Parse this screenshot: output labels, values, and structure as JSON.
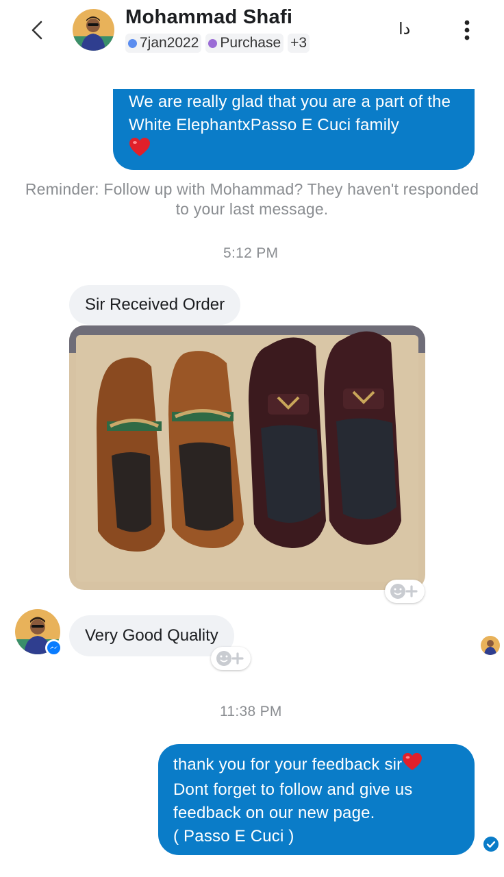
{
  "header": {
    "contact_name": "Mohammad Shafi",
    "tags": [
      {
        "label": "7jan2022",
        "color": "#5b8def"
      },
      {
        "label": "Purchase",
        "color": "#9b6cd6"
      }
    ],
    "more_tags": "+3",
    "translate_label": "دا",
    "icons": {
      "back": "chevron-left-icon",
      "more": "vertical-ellipsis-icon"
    }
  },
  "messages": {
    "m1": {
      "text": "We are really glad that you are a part of the White ElephantxPasso E Cuci family",
      "emoji": "heart-emoji",
      "direction": "outgoing"
    },
    "reminder": "Reminder: Follow up with Mohammad? They haven't responded to your last message.",
    "time1": "5:12 PM",
    "m2": {
      "text": "Sir Received Order",
      "direction": "incoming"
    },
    "m3": {
      "text": "Very Good Quality",
      "direction": "incoming"
    },
    "time2": "11:38 PM",
    "m4": {
      "line1": "thank you for your feedback sir",
      "line2": "Dont forget to follow and give us",
      "line3": "feedback on our new page.",
      "line4": "( Passo E Cuci )",
      "direction": "outgoing"
    }
  },
  "colors": {
    "outgoing_bubble": "#0a7cc8",
    "incoming_bubble": "#f0f2f5",
    "messenger_badge": "#0a7cff"
  }
}
